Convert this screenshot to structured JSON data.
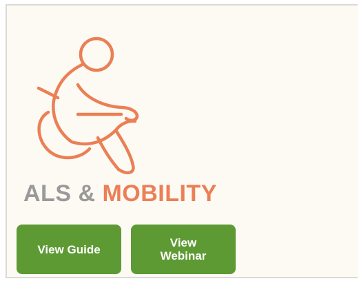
{
  "card": {
    "title_part1": "ALS & ",
    "title_part2": "MOBILITY",
    "icon": "wheelchair-user-icon",
    "colors": {
      "accent_orange": "#eb7f55",
      "title_gray": "#9a9a9a",
      "button_green": "#5e9a34",
      "card_background": "#fdfaf4"
    }
  },
  "buttons": {
    "view_guide": "View Guide",
    "view_webinar_line1": "View",
    "view_webinar_line2": "Webinar"
  }
}
